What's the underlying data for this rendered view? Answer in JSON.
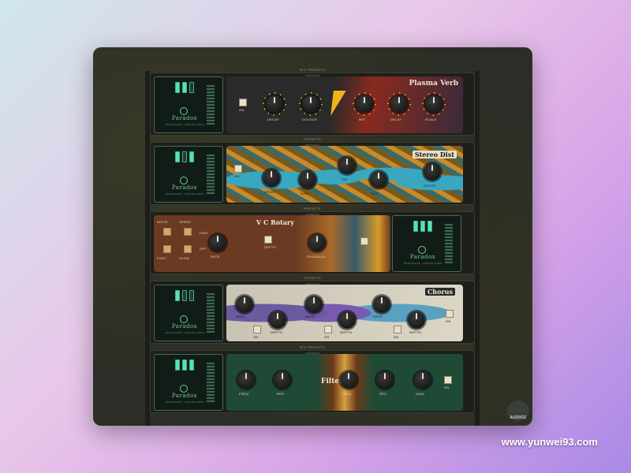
{
  "units": [
    {
      "top_label": "RIO PRESETS",
      "title": "Plasma Verb",
      "knobs": [
        "DECAY",
        "COLOUR",
        "MIX",
        "DELAY",
        "SCALE"
      ],
      "toggle": "ON"
    },
    {
      "top_label": "PRESETS",
      "title": "Stereo Dist",
      "knobs": [
        "DRIVE",
        "BIAS",
        "SAT",
        "MIX",
        "ROUTE"
      ],
      "toggle": "ON"
    },
    {
      "top_label": "PRESETS",
      "title": "V C Rotary",
      "knobs": [
        "RATE",
        "DEPTH",
        "FEEDBACK"
      ],
      "buttons": [
        "DRIVE",
        "SPEED",
        "FAST",
        "FOOT",
        "SLOW",
        "OFF"
      ]
    },
    {
      "top_label": "PRESETS",
      "title": "Chorus",
      "knobs": [
        "RATE",
        "DEPTH",
        "RATE",
        "DEPTH",
        "RATE",
        "DEPTH"
      ],
      "toggles": [
        "ON",
        "ON",
        "ON",
        "ON"
      ]
    },
    {
      "top_label": "RIO PRESETS",
      "title": "Filter",
      "knobs": [
        "FREQ",
        "RES",
        "FREQ",
        "RES",
        "GAIN"
      ],
      "toggle": "ON"
    }
  ],
  "paradox": {
    "name": "Paradox",
    "sub": "TRUE ANALOG · CONSTELLATION"
  },
  "brand": "AUDIOZ",
  "watermark": "www.yunwei93.com",
  "colors": {
    "accent": "#f2b21a",
    "paradox_green": "#58e0b7"
  }
}
